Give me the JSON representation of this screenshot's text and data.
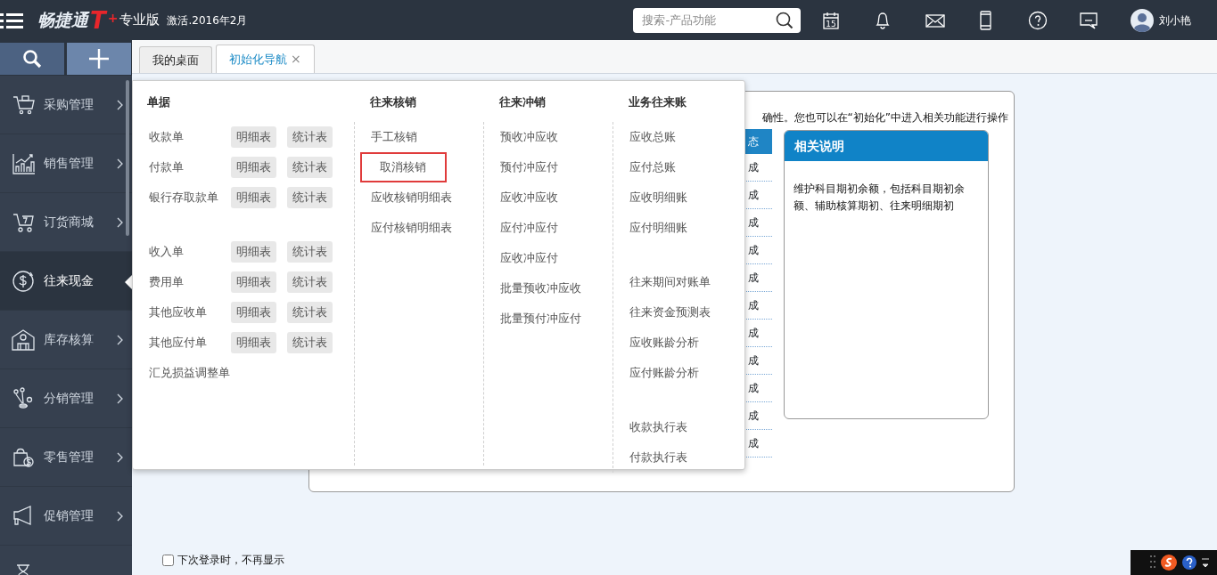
{
  "header": {
    "brand": "畅捷通",
    "brand_mark": "T",
    "brand_sup": "+",
    "edition": "专业版",
    "activation": "激活.2016年2月",
    "search": {
      "placeholder": "搜索-产品功能"
    },
    "calendar_day": "15",
    "user": "刘小艳"
  },
  "sidebar": {
    "items": [
      {
        "label": "采购管理",
        "selected": false
      },
      {
        "label": "销售管理",
        "selected": false
      },
      {
        "label": "订货商城",
        "selected": false
      },
      {
        "label": "往来现金",
        "selected": true
      },
      {
        "label": "库存核算",
        "selected": false
      },
      {
        "label": "分销管理",
        "selected": false
      },
      {
        "label": "零售管理",
        "selected": false
      },
      {
        "label": "促销管理",
        "selected": false
      },
      {
        "selected": false
      }
    ]
  },
  "tabs": [
    {
      "label": "我的桌面",
      "selected": false
    },
    {
      "label": "初始化导航",
      "selected": true,
      "close": "×"
    }
  ],
  "menu": {
    "columns": [
      {
        "title": "单据",
        "groups": [
          [
            {
              "label": "收款单",
              "links": [
                "明细表",
                "统计表"
              ]
            },
            {
              "label": "付款单",
              "links": [
                "明细表",
                "统计表"
              ]
            },
            {
              "label": "银行存取款单",
              "links": [
                "明细表",
                "统计表"
              ]
            }
          ],
          [
            {
              "label": "收入单",
              "links": [
                "明细表",
                "统计表"
              ]
            },
            {
              "label": "费用单",
              "links": [
                "明细表",
                "统计表"
              ]
            },
            {
              "label": "其他应收单",
              "links": [
                "明细表",
                "统计表"
              ]
            },
            {
              "label": "其他应付单",
              "links": [
                "明细表",
                "统计表"
              ]
            },
            {
              "label": "汇兑损益调整单"
            }
          ]
        ]
      },
      {
        "title": "往来核销",
        "groups": [
          [
            {
              "label": "手工核销",
              "highlighted": false
            },
            {
              "label": "取消核销",
              "highlighted": true
            },
            {
              "label": "应收核销明细表",
              "highlighted": false
            },
            {
              "label": "应付核销明细表",
              "highlighted": false
            }
          ]
        ]
      },
      {
        "title": "往来冲销",
        "groups": [
          [
            {
              "label": "预收冲应收"
            },
            {
              "label": "预付冲应付"
            },
            {
              "label": "应收冲应收"
            },
            {
              "label": "应付冲应付"
            },
            {
              "label": "应收冲应付"
            },
            {
              "label": "批量预收冲应收"
            },
            {
              "label": "批量预付冲应付"
            }
          ]
        ]
      },
      {
        "title": "业务往来账",
        "groups": [
          [
            {
              "label": "应收总账"
            },
            {
              "label": "应付总账"
            },
            {
              "label": "应收明细账"
            },
            {
              "label": "应付明细账"
            }
          ],
          [
            {
              "label": "往来期间对账单"
            },
            {
              "label": "往来资金预测表"
            },
            {
              "label": "应收账龄分析"
            },
            {
              "label": "应付账龄分析"
            }
          ],
          [
            {
              "label": "收款执行表"
            },
            {
              "label": "付款执行表"
            }
          ]
        ]
      }
    ]
  },
  "page": {
    "intro": "确性。您也可以在“初始化”中进入相关功能进行操作",
    "status_header": "态",
    "status_cells": [
      "成",
      "成",
      "成",
      "成",
      "成",
      "成",
      "成",
      "成",
      "成",
      "成",
      "成"
    ],
    "note": {
      "title": "相关说明",
      "text": "维护科目期初余额，包括科目期初余额、辅助核算期初、往来明细期初"
    }
  },
  "footer": {
    "checkbox": {
      "label": "下次登录时，不再显示",
      "checked": false
    }
  }
}
